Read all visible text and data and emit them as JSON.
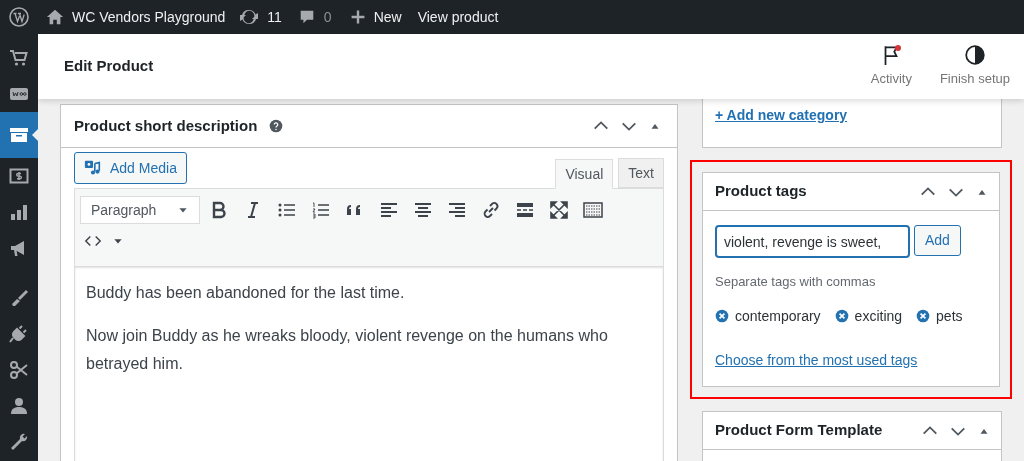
{
  "admin_bar": {
    "site_name": "WC Vendors Playground",
    "updates": "11",
    "comments": "0",
    "new": "New",
    "view": "View product"
  },
  "sidebar": {
    "items": [
      {
        "selected": false
      },
      {
        "selected": false
      },
      {
        "selected": true
      },
      {
        "selected": false
      },
      {
        "selected": false
      },
      {
        "selected": false
      },
      {
        "selected": false
      },
      {
        "selected": false
      },
      {
        "selected": false
      },
      {
        "selected": false
      },
      {
        "selected": false
      }
    ]
  },
  "header": {
    "title": "Edit Product",
    "actions": [
      {
        "label": "Activity",
        "notification": true
      },
      {
        "label": "Finish setup",
        "notification": false
      }
    ]
  },
  "short_description": {
    "title": "Product short description",
    "add_media": "Add Media",
    "tabs": [
      {
        "label": "Visual",
        "selected": true
      },
      {
        "label": "Text",
        "selected": false
      }
    ],
    "format": "Paragraph",
    "paragraphs": [
      "Buddy has been abandoned for the last time.",
      "Now join Buddy as he wreaks bloody, violent revenge on the humans who betrayed him."
    ]
  },
  "categories": {
    "add_link": "+ Add new category"
  },
  "product_tags": {
    "title": "Product tags",
    "highlighted": true,
    "input_value": "violent, revenge is sweet,",
    "add_button": "Add",
    "hint": "Separate tags with commas",
    "tags": [
      "contemporary",
      "exciting",
      "pets"
    ],
    "most_used_link": "Choose from the most used tags"
  },
  "form_template": {
    "title": "Product Form Template"
  }
}
